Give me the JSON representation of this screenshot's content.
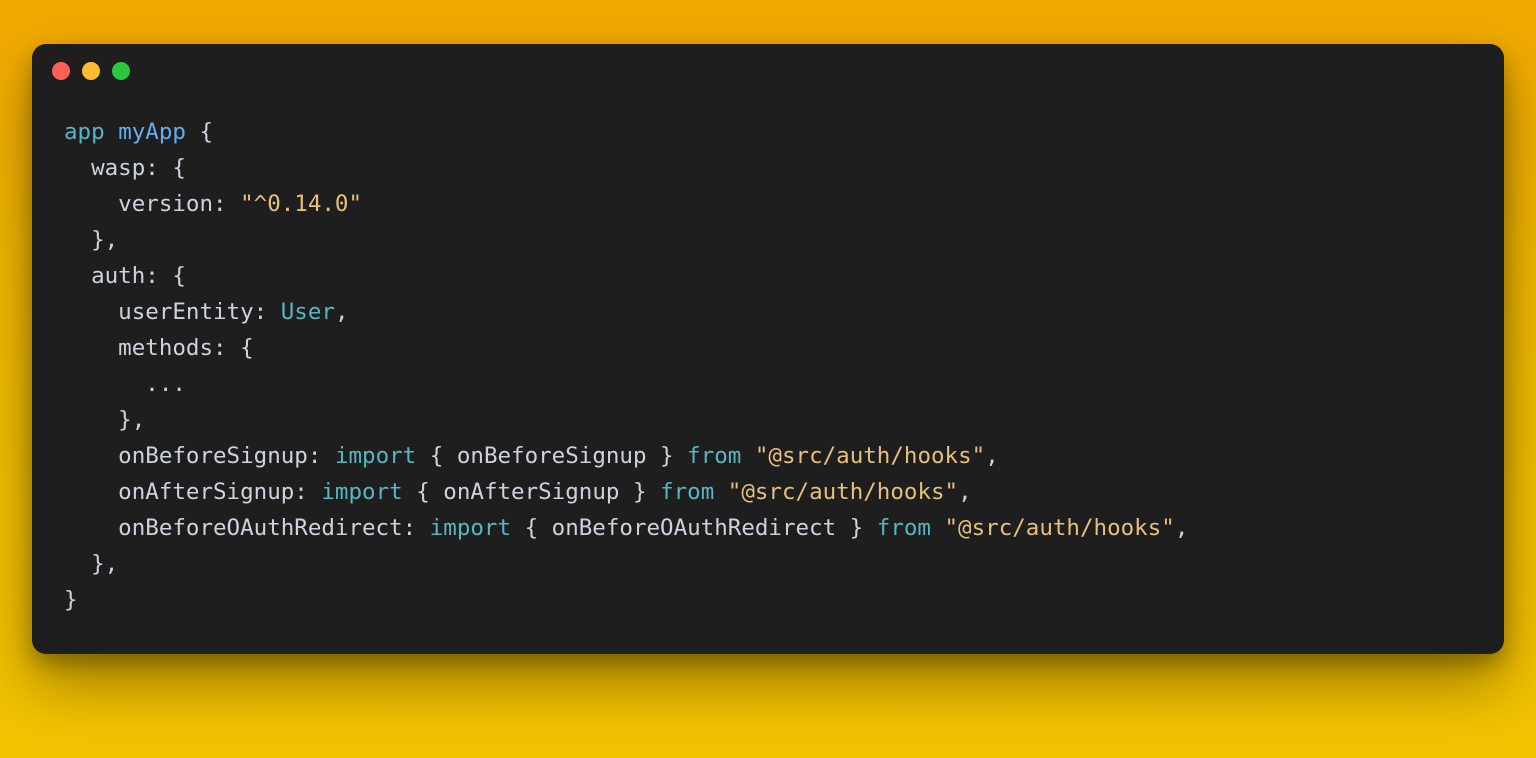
{
  "window": {
    "traffic_lights": [
      "close",
      "minimize",
      "zoom"
    ]
  },
  "code": {
    "tokens": [
      [
        {
          "t": "app",
          "c": "kw"
        },
        {
          "t": " ",
          "c": "punc"
        },
        {
          "t": "myApp",
          "c": "name"
        },
        {
          "t": " {",
          "c": "punc"
        }
      ],
      [
        {
          "t": "  wasp",
          "c": "key"
        },
        {
          "t": ": {",
          "c": "punc"
        }
      ],
      [
        {
          "t": "    version",
          "c": "key"
        },
        {
          "t": ": ",
          "c": "punc"
        },
        {
          "t": "\"^0.14.0\"",
          "c": "str"
        }
      ],
      [
        {
          "t": "  },",
          "c": "punc"
        }
      ],
      [
        {
          "t": "  auth",
          "c": "key"
        },
        {
          "t": ": {",
          "c": "punc"
        }
      ],
      [
        {
          "t": "    userEntity",
          "c": "key"
        },
        {
          "t": ": ",
          "c": "punc"
        },
        {
          "t": "User",
          "c": "ident"
        },
        {
          "t": ",",
          "c": "punc"
        }
      ],
      [
        {
          "t": "    methods",
          "c": "key"
        },
        {
          "t": ": {",
          "c": "punc"
        }
      ],
      [
        {
          "t": "      ...",
          "c": "other"
        }
      ],
      [
        {
          "t": "    },",
          "c": "punc"
        }
      ],
      [
        {
          "t": "    onBeforeSignup",
          "c": "key"
        },
        {
          "t": ": ",
          "c": "punc"
        },
        {
          "t": "import",
          "c": "ident"
        },
        {
          "t": " { onBeforeSignup } ",
          "c": "punc"
        },
        {
          "t": "from",
          "c": "ident"
        },
        {
          "t": " ",
          "c": "punc"
        },
        {
          "t": "\"@src/auth/hooks\"",
          "c": "str"
        },
        {
          "t": ",",
          "c": "punc"
        }
      ],
      [
        {
          "t": "    onAfterSignup",
          "c": "key"
        },
        {
          "t": ": ",
          "c": "punc"
        },
        {
          "t": "import",
          "c": "ident"
        },
        {
          "t": " { onAfterSignup } ",
          "c": "punc"
        },
        {
          "t": "from",
          "c": "ident"
        },
        {
          "t": " ",
          "c": "punc"
        },
        {
          "t": "\"@src/auth/hooks\"",
          "c": "str"
        },
        {
          "t": ",",
          "c": "punc"
        }
      ],
      [
        {
          "t": "    onBeforeOAuthRedirect",
          "c": "key"
        },
        {
          "t": ": ",
          "c": "punc"
        },
        {
          "t": "import",
          "c": "ident"
        },
        {
          "t": " { onBeforeOAuthRedirect } ",
          "c": "punc"
        },
        {
          "t": "from",
          "c": "ident"
        },
        {
          "t": " ",
          "c": "punc"
        },
        {
          "t": "\"@src/auth/hooks\"",
          "c": "str"
        },
        {
          "t": ",",
          "c": "punc"
        }
      ],
      [
        {
          "t": "  },",
          "c": "punc"
        }
      ],
      [
        {
          "t": "}",
          "c": "punc"
        }
      ]
    ]
  }
}
